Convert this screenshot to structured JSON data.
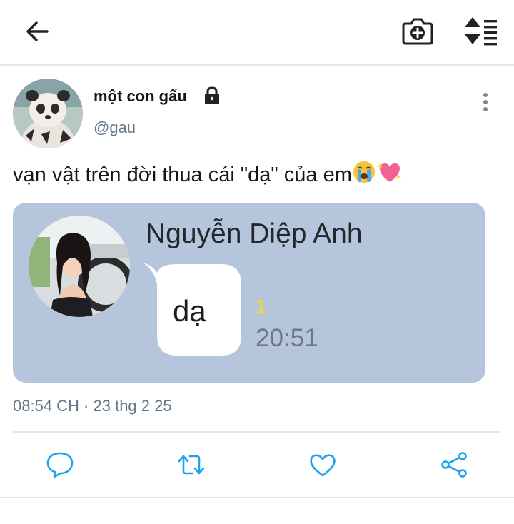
{
  "header": {
    "back_icon": "arrow-left-icon",
    "camera_icon": "camera-plus-icon",
    "sort_icon": "sort-vertical-icon"
  },
  "tweet": {
    "display_name": "một con gấu",
    "handle": "@gau",
    "protected_icon": "lock-icon",
    "more_icon": "more-vertical-icon",
    "text": "vạn vật trên đời thua cái \"dạ\" của em",
    "emoji": [
      "crying-face",
      "sparkling-heart"
    ],
    "timestamp": "08:54 CH · 23 thg 2 25"
  },
  "media": {
    "contact_name": "Nguyễn Diệp Anh",
    "message": "dạ",
    "read_count": "1",
    "time": "20:51"
  },
  "actions": [
    {
      "name": "reply-icon"
    },
    {
      "name": "retweet-icon"
    },
    {
      "name": "like-icon"
    },
    {
      "name": "share-icon"
    }
  ],
  "colors": {
    "text_primary": "#14171a",
    "text_secondary": "#657786",
    "icon": "#1da1f2",
    "media_bg": "#b5c6dc"
  }
}
